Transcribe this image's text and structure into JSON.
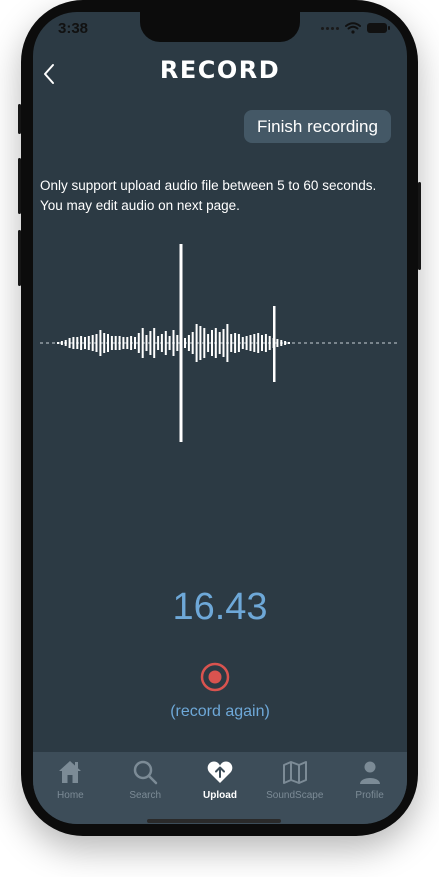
{
  "status_bar": {
    "time": "3:38"
  },
  "header": {
    "title": "RECORD"
  },
  "actions": {
    "finish_label": "Finish recording"
  },
  "info": {
    "message": "Only support upload audio file between 5 to 60 seconds. You may edit audio on next page."
  },
  "recorder": {
    "elapsed": "16.43",
    "record_again_label": "(record again)",
    "record_color": "#d9534f"
  },
  "tabbar": {
    "tabs": [
      {
        "label": "Home",
        "icon": "home-icon",
        "active": false
      },
      {
        "label": "Search",
        "icon": "search-icon",
        "active": false
      },
      {
        "label": "Upload",
        "icon": "upload-heart-icon",
        "active": true
      },
      {
        "label": "SoundScape",
        "icon": "map-icon",
        "active": false
      },
      {
        "label": "Profile",
        "icon": "profile-icon",
        "active": false
      }
    ]
  },
  "colors": {
    "background": "#2c3a44",
    "accent": "#6ea8d8",
    "tabbar": "#3d4d59",
    "button": "#445866"
  }
}
